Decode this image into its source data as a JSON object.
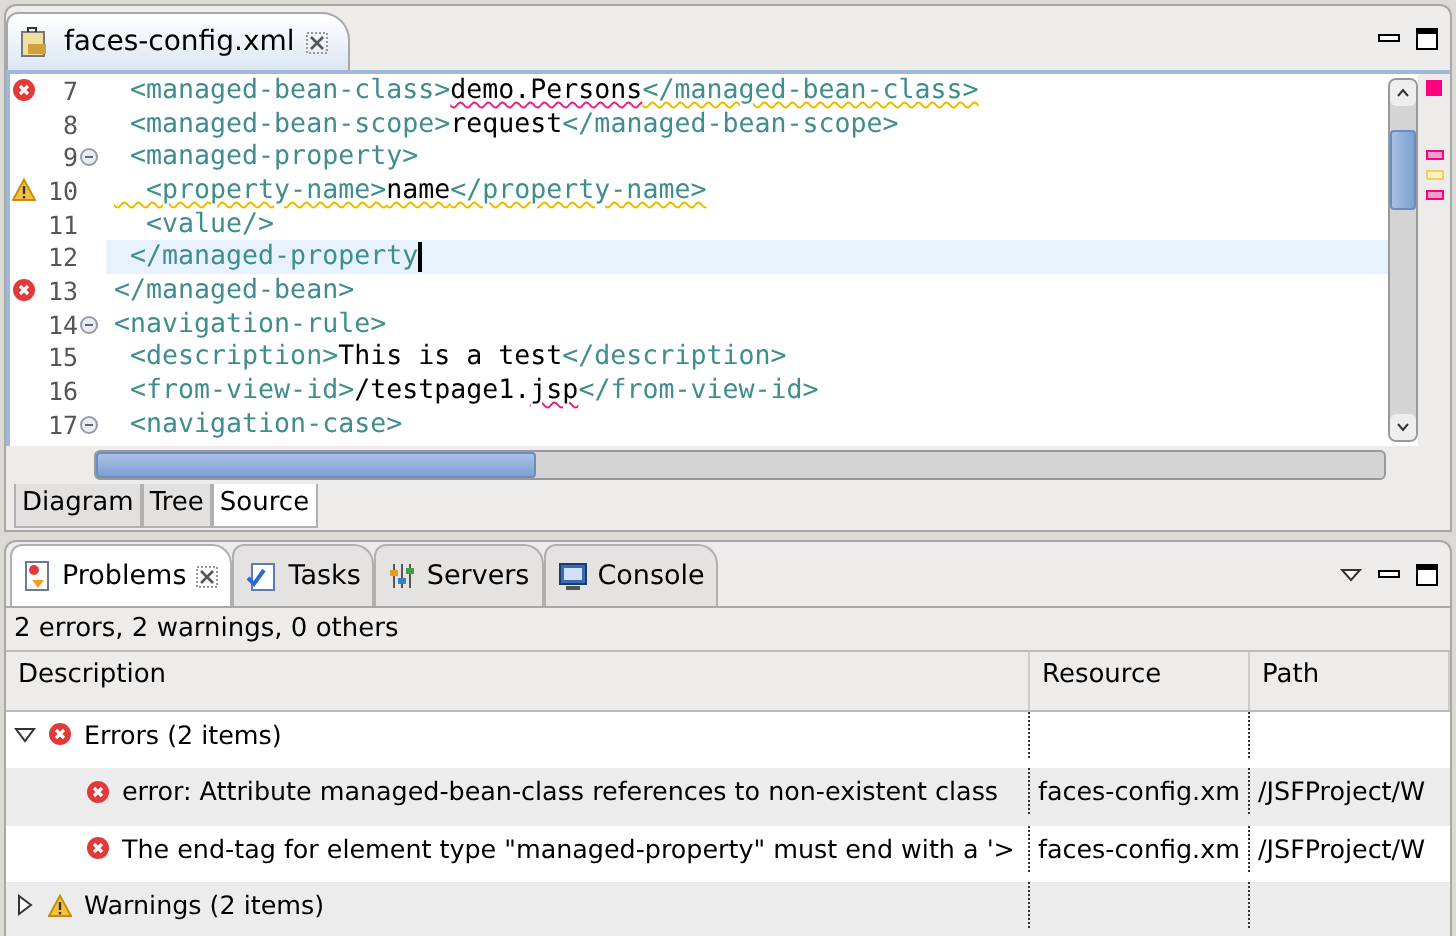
{
  "editor": {
    "tab": {
      "label": "faces-config.xml"
    },
    "lines": [
      {
        "num": "7",
        "error": true,
        "warning": false,
        "fold": false,
        "current": false,
        "segments": [
          {
            "kind": "tag",
            "text": " <managed-bean-class>"
          },
          {
            "kind": "text",
            "text": "demo.Persons",
            "error_underline": true
          },
          {
            "kind": "tag",
            "text": "</managed-bean-class>",
            "warning_underline": true
          }
        ]
      },
      {
        "num": "8",
        "error": false,
        "warning": false,
        "fold": false,
        "current": false,
        "segments": [
          {
            "kind": "tag",
            "text": " <managed-bean-scope>"
          },
          {
            "kind": "text",
            "text": "request"
          },
          {
            "kind": "tag",
            "text": "</managed-bean-scope>"
          }
        ]
      },
      {
        "num": "9",
        "error": false,
        "warning": false,
        "fold": true,
        "current": false,
        "segments": [
          {
            "kind": "tag",
            "text": " <managed-property>"
          }
        ]
      },
      {
        "num": "10",
        "error": false,
        "warning": true,
        "fold": false,
        "current": false,
        "segments": [
          {
            "kind": "tag",
            "text": "  <property-name>",
            "warning_underline": true
          },
          {
            "kind": "text",
            "text": "name",
            "warning_underline": true
          },
          {
            "kind": "tag",
            "text": "</property-name>",
            "warning_underline": true
          }
        ]
      },
      {
        "num": "11",
        "error": false,
        "warning": false,
        "fold": false,
        "current": false,
        "segments": [
          {
            "kind": "tag",
            "text": "  <value/>"
          }
        ]
      },
      {
        "num": "12",
        "error": false,
        "warning": false,
        "fold": false,
        "current": true,
        "segments": [
          {
            "kind": "tag",
            "text": " </managed-property"
          }
        ]
      },
      {
        "num": "13",
        "error": true,
        "warning": false,
        "fold": false,
        "current": false,
        "segments": [
          {
            "kind": "tag",
            "text": "</managed-bean>"
          }
        ]
      },
      {
        "num": "14",
        "error": false,
        "warning": false,
        "fold": true,
        "current": false,
        "segments": [
          {
            "kind": "tag",
            "text": "<navigation-rule>"
          }
        ]
      },
      {
        "num": "15",
        "error": false,
        "warning": false,
        "fold": false,
        "current": false,
        "segments": [
          {
            "kind": "tag",
            "text": " <description>"
          },
          {
            "kind": "text",
            "text": "This is a test"
          },
          {
            "kind": "tag",
            "text": "</description>"
          }
        ]
      },
      {
        "num": "16",
        "error": false,
        "warning": false,
        "fold": false,
        "current": false,
        "segments": [
          {
            "kind": "tag",
            "text": " <from-view-id>"
          },
          {
            "kind": "text",
            "text": "/testpage1."
          },
          {
            "kind": "text",
            "text": "jsp",
            "error_underline": true
          },
          {
            "kind": "tag",
            "text": "</from-view-id>"
          }
        ]
      },
      {
        "num": "17",
        "error": false,
        "warning": false,
        "fold": true,
        "current": false,
        "segments": [
          {
            "kind": "tag",
            "text": " <navigation-case>"
          }
        ]
      }
    ],
    "overview_summary": {
      "kind": "error"
    },
    "overview_marks": [
      {
        "kind": "error"
      },
      {
        "kind": "warning"
      },
      {
        "kind": "error"
      }
    ],
    "page_tabs": [
      {
        "label": "Diagram",
        "selected": false
      },
      {
        "label": "Tree",
        "selected": false
      },
      {
        "label": "Source",
        "selected": true
      }
    ]
  },
  "views": {
    "tabs": [
      {
        "label": "Problems",
        "kind": "problems",
        "selected": true
      },
      {
        "label": "Tasks",
        "kind": "tasks",
        "selected": false
      },
      {
        "label": "Servers",
        "kind": "servers",
        "selected": false
      },
      {
        "label": "Console",
        "kind": "console",
        "selected": false
      }
    ],
    "summary": "2 errors, 2 warnings, 0 others",
    "columns": [
      "Description",
      "Resource",
      "Path"
    ],
    "groups": [
      {
        "label": "Errors (2 items)",
        "kind": "error",
        "expanded": true,
        "children": [
          {
            "description": "error: Attribute managed-bean-class references to non-existent class",
            "resource": "faces-config.xm",
            "path": "/JSFProject/W",
            "kind": "error"
          },
          {
            "description": "The end-tag for element type \"managed-property\" must end with a '>",
            "resource": "faces-config.xm",
            "path": "/JSFProject/W",
            "kind": "error"
          }
        ]
      },
      {
        "label": "Warnings (2 items)",
        "kind": "warning",
        "expanded": false
      }
    ]
  }
}
